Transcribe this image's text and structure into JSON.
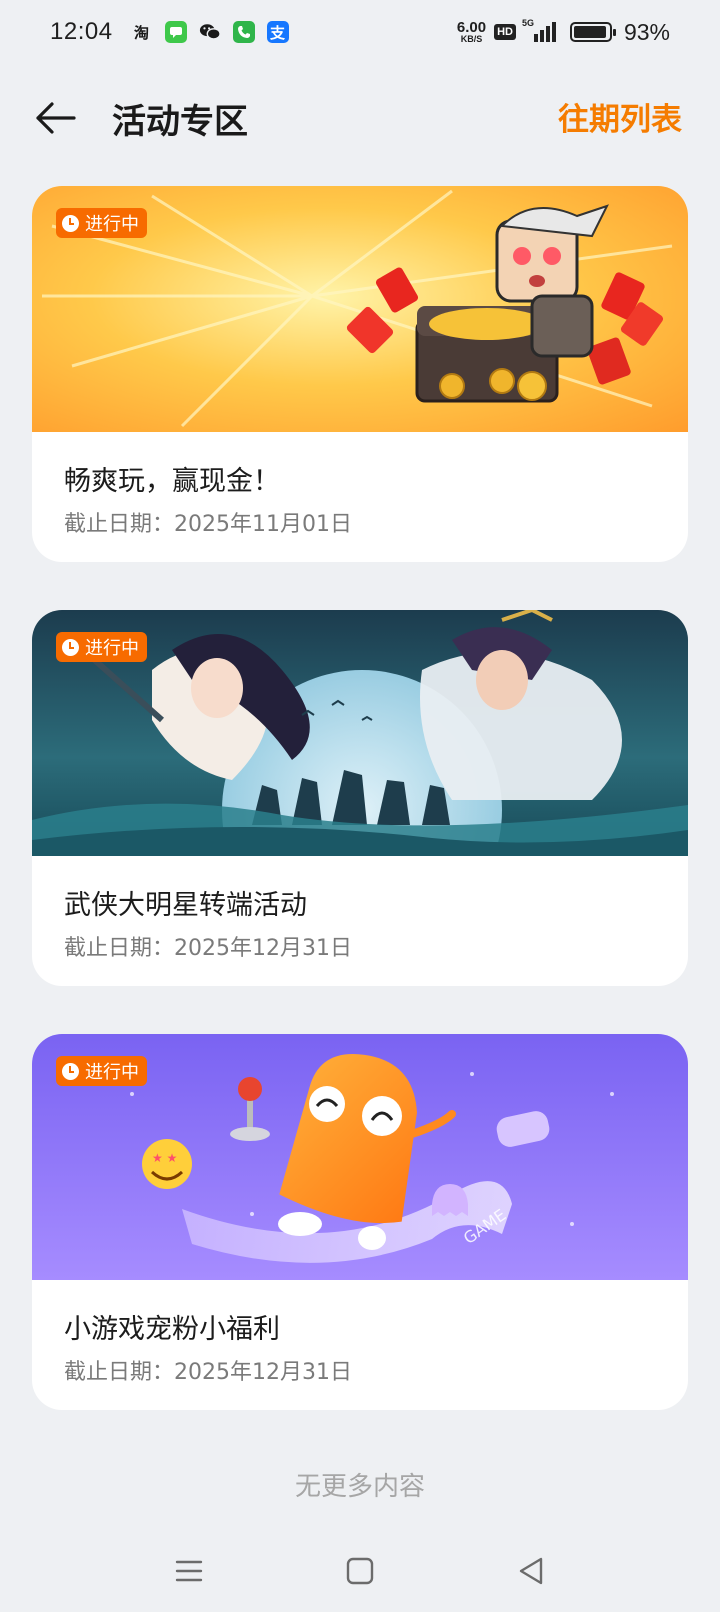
{
  "status_bar": {
    "time": "12:04",
    "notifications": [
      {
        "icon": "taobao-icon",
        "glyph": "淘",
        "color": "#ffffff",
        "text_color": "#1a1a1a"
      },
      {
        "icon": "messages-icon",
        "glyph": "",
        "color": "#3ec84a"
      },
      {
        "icon": "wechat-icon",
        "glyph": "",
        "color": "#ffffff"
      },
      {
        "icon": "phone-icon",
        "glyph": "",
        "color": "#2fb54a"
      },
      {
        "icon": "alipay-icon",
        "glyph": "支",
        "color": "#1677ff"
      }
    ],
    "net_speed_value": "6.00",
    "net_speed_unit": "KB/S",
    "hd_label": "HD",
    "network_label": "5G",
    "battery_percent": "93%",
    "battery_level": 0.93
  },
  "header": {
    "title": "活动专区",
    "history_link": "往期列表"
  },
  "cards": [
    {
      "status": "进行中",
      "title": "畅爽玩，赢现金！",
      "deadline": "截止日期：2025年11月01日",
      "banner_theme": "treasure-gold"
    },
    {
      "status": "进行中",
      "title": "武侠大明星转端活动",
      "deadline": "截止日期：2025年12月31日",
      "banner_theme": "wuxia-night"
    },
    {
      "status": "进行中",
      "title": "小游戏宠粉小福利",
      "deadline": "截止日期：2025年12月31日",
      "banner_theme": "purple-mascot"
    }
  ],
  "footer": {
    "no_more": "无更多内容"
  },
  "nav_bar": {
    "buttons": [
      "menu-icon",
      "home-icon",
      "back-triangle-icon"
    ]
  },
  "colors": {
    "accent": "#f57c00",
    "badge": "#f76b00",
    "background": "#eef0f3"
  }
}
